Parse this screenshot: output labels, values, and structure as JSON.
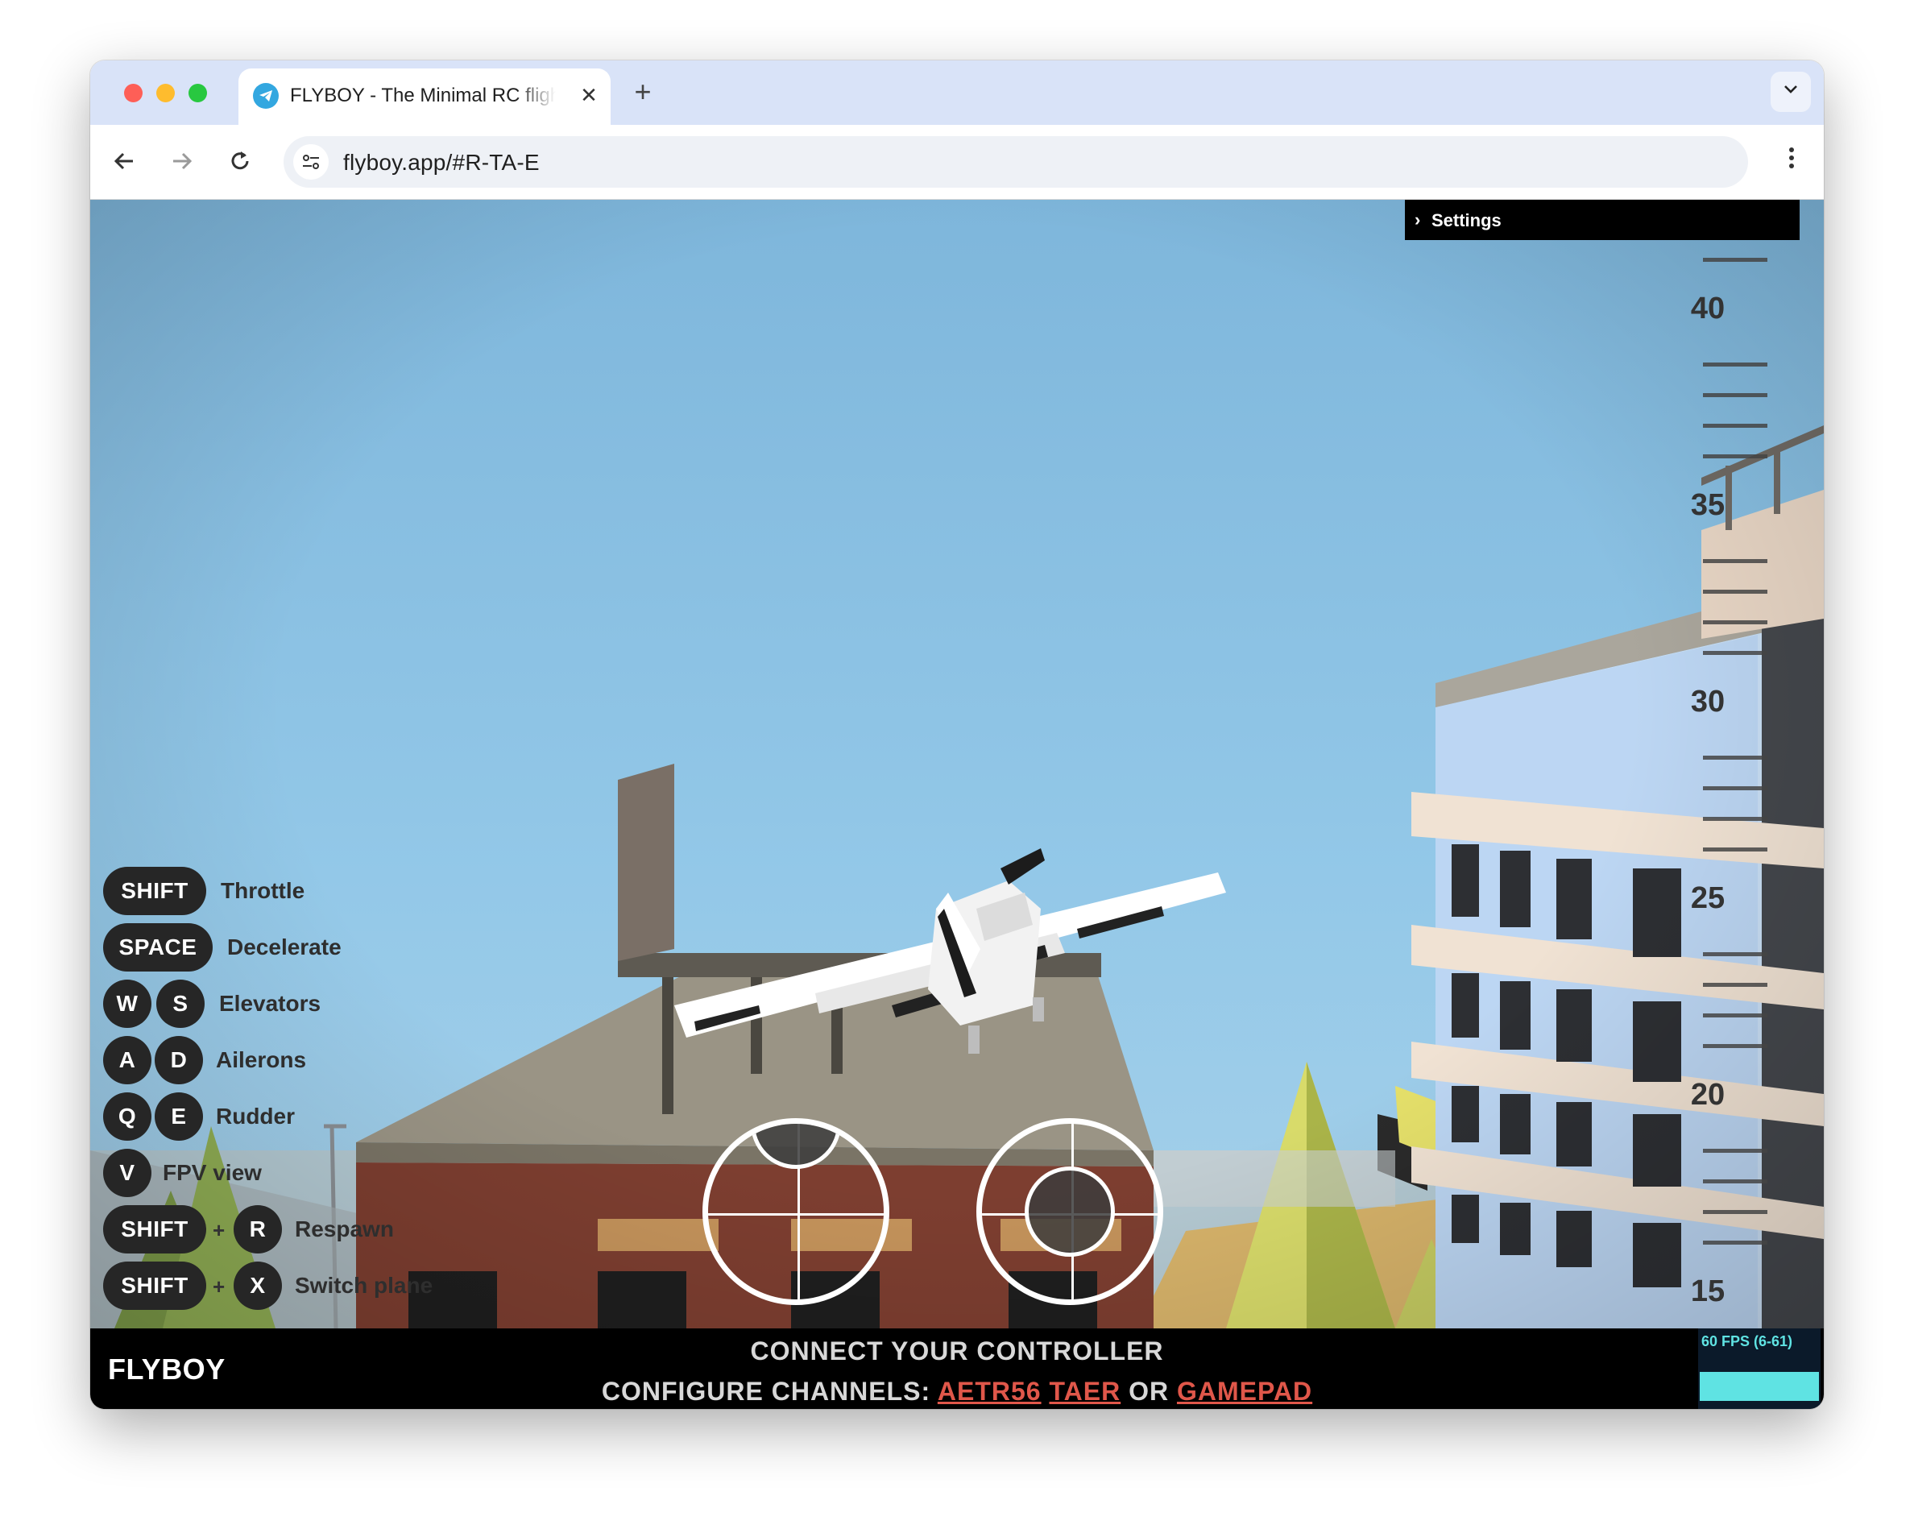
{
  "browser": {
    "tab_title": "FLYBOY - The Minimal RC flight simulator",
    "url": "flyboy.app/#R-TA-E"
  },
  "settings": {
    "label": "Settings"
  },
  "altimeter": {
    "labels": [
      "40",
      "35",
      "30",
      "25",
      "20",
      "15"
    ]
  },
  "controls": [
    {
      "keys": [
        "SHIFT"
      ],
      "action": "Throttle"
    },
    {
      "keys": [
        "SPACE"
      ],
      "action": "Decelerate"
    },
    {
      "keys": [
        "W",
        "S"
      ],
      "action": "Elevators"
    },
    {
      "keys": [
        "A",
        "D"
      ],
      "action": "Ailerons"
    },
    {
      "keys": [
        "Q",
        "E"
      ],
      "action": "Rudder"
    },
    {
      "keys": [
        "V"
      ],
      "action": "FPV view"
    },
    {
      "keys": [
        "SHIFT",
        "R"
      ],
      "joiner": "+",
      "action": "Respawn"
    },
    {
      "keys": [
        "SHIFT",
        "X"
      ],
      "joiner": "+",
      "action": "Switch plane"
    }
  ],
  "footer": {
    "brand": "FLYBOY",
    "connect": "CONNECT YOUR CONTROLLER",
    "configure_prefix": "CONFIGURE CHANNELS:",
    "link1": "AETR56",
    "link2": "TAER",
    "or": "OR",
    "link3": "GAMEPAD",
    "fps": "60 FPS (6-61)"
  },
  "sticks": {
    "left": {
      "x": 0.0,
      "y": 1.0
    },
    "right": {
      "x": 0.0,
      "y": 0.0
    }
  },
  "colors": {
    "sky": "#8cc4e6",
    "accent_link": "#e0574a",
    "fps_graph": "#5fe3e3"
  }
}
